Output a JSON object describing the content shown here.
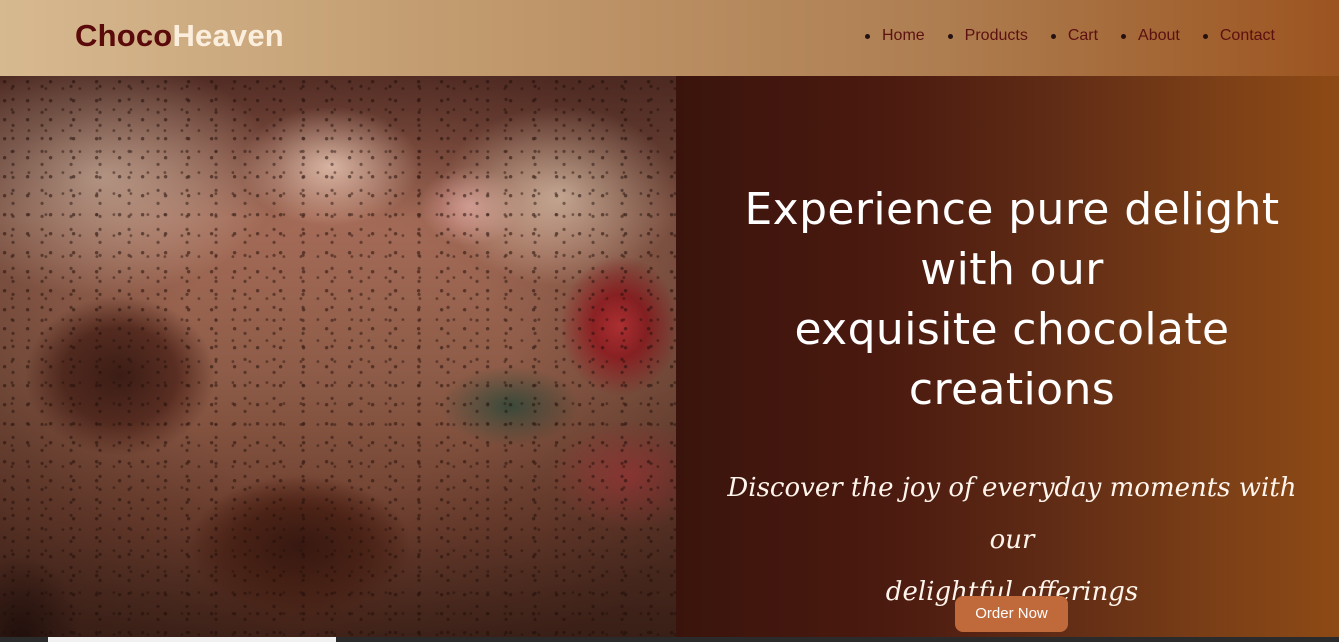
{
  "header": {
    "logo": {
      "part1": "Choco",
      "part2": "Heaven"
    },
    "nav": [
      {
        "label": "Home"
      },
      {
        "label": "Products"
      },
      {
        "label": "Cart"
      },
      {
        "label": "About"
      },
      {
        "label": "Contact"
      }
    ]
  },
  "hero": {
    "heading": "Experience pure delight\nwith our\nexquisite chocolate\ncreations",
    "tagline": "Discover the joy of everyday moments with our\ndelightful offerings",
    "cta_label": "Order Now"
  },
  "colors": {
    "logo_primary": "#5a0a0a",
    "logo_secondary": "#fbeedd",
    "nav_text": "#5c1010",
    "cta_background": "#c06a3c",
    "hero_panel_start": "#3a140c",
    "hero_panel_end": "#8e4a15"
  }
}
